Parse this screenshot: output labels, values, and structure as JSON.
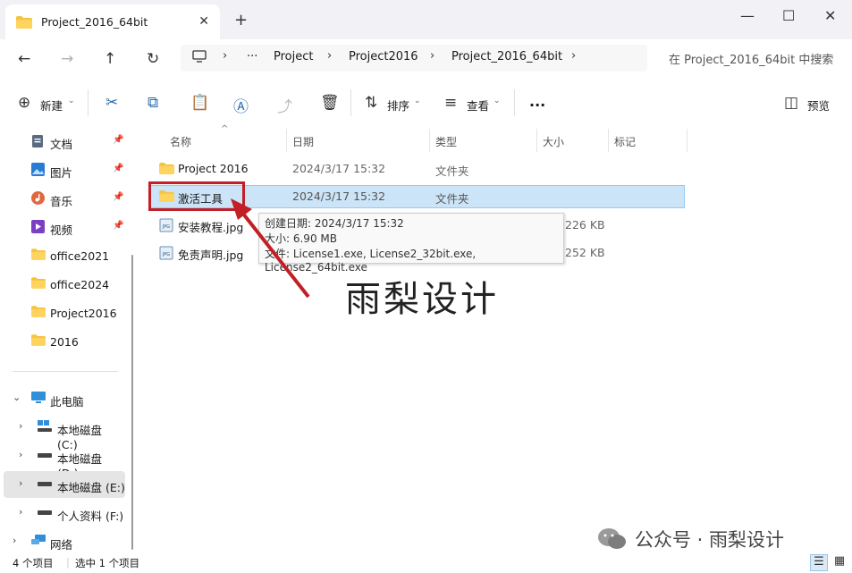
{
  "window": {
    "tab_title": "Project_2016_64bit",
    "close_tab": "✕",
    "new_tab": "+",
    "minimize": "—",
    "maximize": "☐",
    "close": "✕"
  },
  "address": {
    "more": "···",
    "crumbs": [
      "Project",
      "Project2016",
      "Project_2016_64bit"
    ],
    "search_placeholder": "在 Project_2016_64bit 中搜索"
  },
  "toolbar": {
    "new_label": "新建",
    "sort_label": "排序",
    "view_label": "查看",
    "more": "···",
    "preview_label": "预览"
  },
  "sidebar": {
    "quick_items": [
      {
        "label": "文档",
        "icon": "documents-icon"
      },
      {
        "label": "图片",
        "icon": "pictures-icon"
      },
      {
        "label": "音乐",
        "icon": "music-icon"
      },
      {
        "label": "视频",
        "icon": "videos-icon"
      },
      {
        "label": "office2021",
        "icon": "folder-icon"
      },
      {
        "label": "office2024",
        "icon": "folder-icon"
      },
      {
        "label": "Project2016",
        "icon": "folder-icon"
      },
      {
        "label": "2016",
        "icon": "folder-icon"
      }
    ],
    "this_pc": "此电脑",
    "drives": [
      {
        "label": "本地磁盘 (C:)"
      },
      {
        "label": "本地磁盘 (D:)"
      },
      {
        "label": "本地磁盘 (E:)"
      },
      {
        "label": "个人资料 (F:)"
      }
    ],
    "network": "网络"
  },
  "columns": {
    "name": "名称",
    "date": "日期",
    "type": "类型",
    "size": "大小",
    "tag": "标记"
  },
  "files": [
    {
      "name": "Project 2016",
      "date": "2024/3/17 15:32",
      "type": "文件夹",
      "size": "",
      "kind": "folder"
    },
    {
      "name": "激活工具",
      "date": "2024/3/17 15:32",
      "type": "文件夹",
      "size": "",
      "kind": "folder"
    },
    {
      "name": "安装教程.jpg",
      "date": "",
      "type": "",
      "size": "226 KB",
      "kind": "jpg"
    },
    {
      "name": "免责声明.jpg",
      "date": "",
      "type": "",
      "size": "252 KB",
      "kind": "jpg"
    }
  ],
  "tooltip": {
    "created": "创建日期: 2024/3/17 15:32",
    "size": "大小: 6.90 MB",
    "files": "文件: License1.exe, License2_32bit.exe, License2_64bit.exe"
  },
  "watermark": "雨梨设计",
  "wechat": "公众号 · 雨梨设计",
  "status": {
    "count": "4 个项目",
    "selected": "选中 1 个项目"
  },
  "colors": {
    "folder": "#f5c342",
    "selection": "#cce4f7",
    "highlight_box": "#c21f27",
    "accent": "#2b6cb0"
  }
}
